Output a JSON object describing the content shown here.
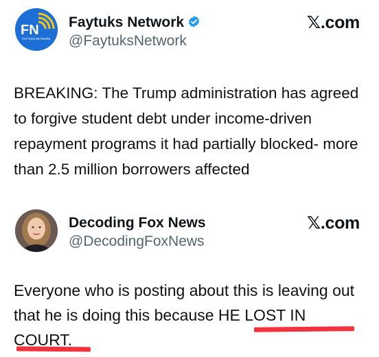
{
  "posts": [
    {
      "display_name": "Faytuks Network",
      "handle": "@FaytuksNetwork",
      "source": "𝕏.com",
      "verified": true,
      "avatar_text": "FN",
      "avatar_subtext": "FAYTUKS NETWORK",
      "text": "BREAKING: The Trump administration has agreed to forgive student debt under income-driven repayment programs it had partially blocked- more than 2.5 million borrowers affected"
    },
    {
      "display_name": "Decoding Fox News",
      "handle": "@DecodingFoxNews",
      "source": "𝕏.com",
      "verified": false,
      "text_before": "Everyone who is posting about this is leaving out that he is doing this because ",
      "text_emphasis": "HE LOST IN COURT."
    }
  ],
  "colors": {
    "accent_blue": "#1d9bf0",
    "avatar_blue": "#1d6fd6",
    "avatar_yellow": "#f5c518",
    "underline_red": "#f0333d",
    "text_primary": "#0f1419",
    "text_secondary": "#536471"
  },
  "icons": {
    "verified": "verified-badge-icon"
  }
}
